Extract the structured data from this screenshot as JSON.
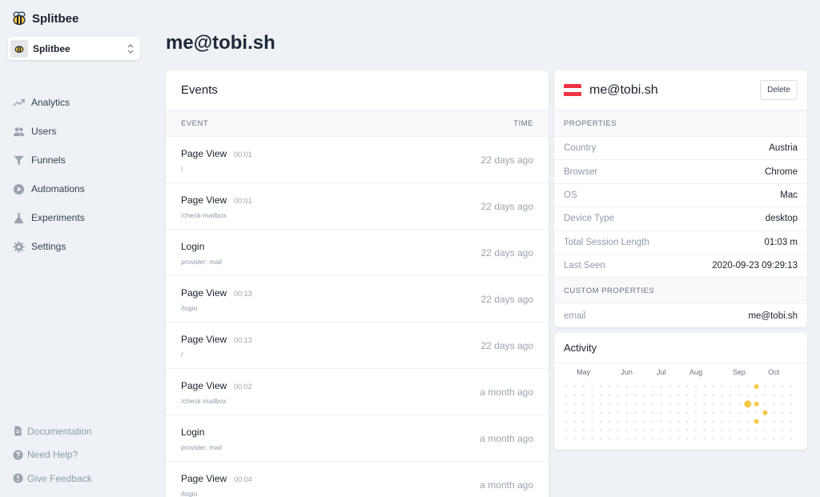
{
  "app": {
    "name": "Splitbee",
    "logo_icon": "bee-icon"
  },
  "project": {
    "name": "Splitbee"
  },
  "nav": [
    {
      "label": "Analytics",
      "icon": "trend-icon"
    },
    {
      "label": "Users",
      "icon": "users-icon"
    },
    {
      "label": "Funnels",
      "icon": "funnel-icon"
    },
    {
      "label": "Automations",
      "icon": "play-circle-icon"
    },
    {
      "label": "Experiments",
      "icon": "flask-icon"
    },
    {
      "label": "Settings",
      "icon": "gear-icon"
    }
  ],
  "bottom_links": [
    {
      "label": "Documentation",
      "icon": "document-icon"
    },
    {
      "label": "Need Help?",
      "icon": "question-icon"
    },
    {
      "label": "Give Feedback",
      "icon": "exclamation-icon"
    }
  ],
  "page_title": "me@tobi.sh",
  "events": {
    "title": "Events",
    "col_event": "EVENT",
    "col_time": "TIME",
    "rows": [
      {
        "name": "Page View",
        "duration": "00:01",
        "detail": "/",
        "time": "22 days ago"
      },
      {
        "name": "Page View",
        "duration": "00:01",
        "detail": "/check-mailbox",
        "time": "22 days ago"
      },
      {
        "name": "Login",
        "duration": "",
        "detail": "provider: mail",
        "time": "22 days ago"
      },
      {
        "name": "Page View",
        "duration": "00:13",
        "detail": "/login",
        "time": "22 days ago"
      },
      {
        "name": "Page View",
        "duration": "00:13",
        "detail": "/",
        "time": "22 days ago"
      },
      {
        "name": "Page View",
        "duration": "00:02",
        "detail": "/check-mailbox",
        "time": "a month ago"
      },
      {
        "name": "Login",
        "duration": "",
        "detail": "provider: mail",
        "time": "a month ago"
      },
      {
        "name": "Page View",
        "duration": "00:04",
        "detail": "/login",
        "time": "a month ago"
      }
    ]
  },
  "user": {
    "name": "me@tobi.sh",
    "flag_colors": [
      "#ef3340",
      "#ffffff",
      "#ef3340"
    ],
    "delete_label": "Delete",
    "properties_title": "PROPERTIES",
    "properties": [
      {
        "key": "Country",
        "value": "Austria"
      },
      {
        "key": "Browser",
        "value": "Chrome"
      },
      {
        "key": "OS",
        "value": "Mac"
      },
      {
        "key": "Device Type",
        "value": "desktop"
      },
      {
        "key": "Total Session Length",
        "value": "01:03 m"
      },
      {
        "key": "Last Seen",
        "value": "2020-09-23 09:29:13"
      }
    ],
    "custom_title": "CUSTOM PROPERTIES",
    "custom": [
      {
        "key": "email",
        "value": "me@tobi.sh"
      }
    ]
  },
  "activity": {
    "title": "Activity",
    "months": [
      "May",
      "Jun",
      "Jul",
      "Aug",
      "Sep",
      "Oct"
    ],
    "accent": "#f6c94a",
    "highlights": [
      {
        "week": 22,
        "day": 0,
        "level": 1
      },
      {
        "week": 21,
        "day": 2,
        "level": 2
      },
      {
        "week": 22,
        "day": 2,
        "level": 1
      },
      {
        "week": 23,
        "day": 3,
        "level": 1
      },
      {
        "week": 22,
        "day": 4,
        "level": 1
      }
    ]
  }
}
